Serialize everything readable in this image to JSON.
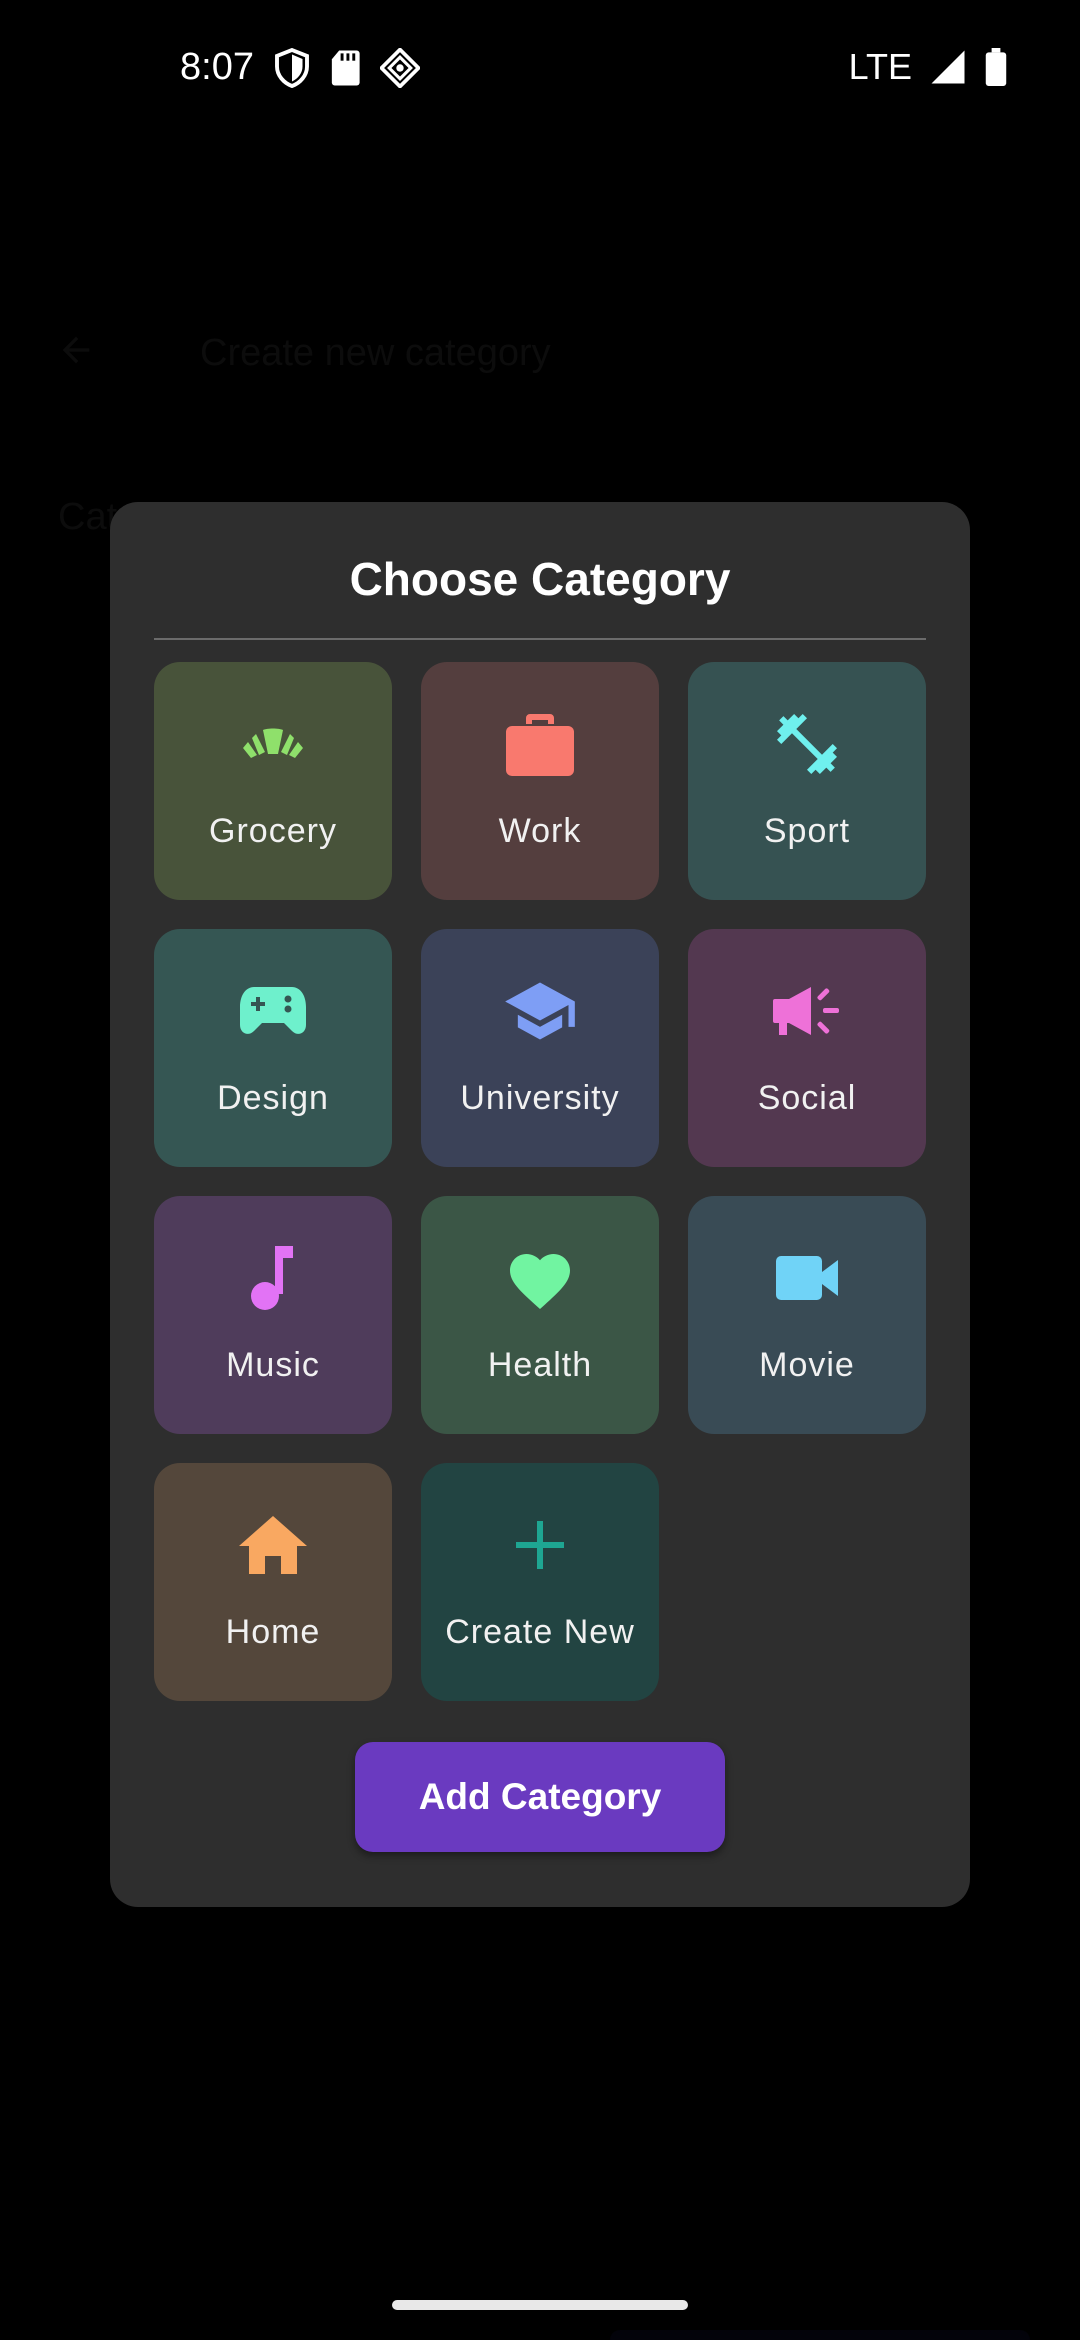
{
  "status_bar": {
    "time": "8:07",
    "network": "LTE",
    "icons": [
      "shield-icon",
      "sd-card-icon",
      "diamond-app-icon",
      "signal-icon",
      "battery-icon"
    ]
  },
  "background": {
    "title": "Create new category",
    "field_label": "Category name"
  },
  "dialog": {
    "title": "Choose Category",
    "categories": [
      {
        "label": "Grocery",
        "icon": "croissant-icon",
        "tile_color": "#48533a",
        "icon_color": "#8fe06b"
      },
      {
        "label": "Work",
        "icon": "briefcase-icon",
        "tile_color": "#543e3e",
        "icon_color": "#f9796e"
      },
      {
        "label": "Sport",
        "icon": "dumbbell-icon",
        "tile_color": "#365252",
        "icon_color": "#6ff0ee"
      },
      {
        "label": "Design",
        "icon": "gamepad-icon",
        "tile_color": "#355653",
        "icon_color": "#6ef0cc"
      },
      {
        "label": "University",
        "icon": "graduation-cap-icon",
        "tile_color": "#3b4258",
        "icon_color": "#7e9ef5"
      },
      {
        "label": "Social",
        "icon": "megaphone-icon",
        "tile_color": "#533850",
        "icon_color": "#ee71d8"
      },
      {
        "label": "Music",
        "icon": "music-note-icon",
        "tile_color": "#4f3c5b",
        "icon_color": "#e273f5"
      },
      {
        "label": "Health",
        "icon": "heart-icon",
        "tile_color": "#3b5646",
        "icon_color": "#71f4a1"
      },
      {
        "label": "Movie",
        "icon": "video-camera-icon",
        "tile_color": "#394b55",
        "icon_color": "#70d3f7"
      },
      {
        "label": "Home",
        "icon": "house-icon",
        "tile_color": "#54473b",
        "icon_color": "#f9a861"
      },
      {
        "label": "Create New",
        "icon": "plus-icon",
        "tile_color": "#224442",
        "icon_color": "#1ea692"
      }
    ],
    "add_button_label": "Add Category",
    "add_button_color": "#6a3ac0"
  }
}
